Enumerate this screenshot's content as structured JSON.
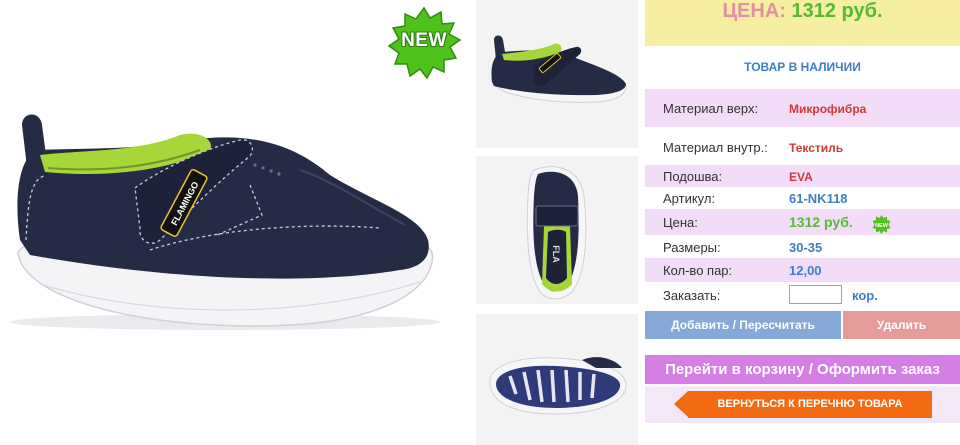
{
  "product": {
    "badge": "NEW",
    "brand_on_shoe": "FLAMINGO",
    "thumb_tongue_text": "FLA"
  },
  "price_banner": {
    "label": "ЦЕНА:",
    "value": "1312 руб."
  },
  "stock_status": "ТОВАР В НАЛИЧИИ",
  "specs": {
    "material_top": {
      "label": "Материал верх:",
      "value": "Микрофибра"
    },
    "material_inner": {
      "label": "Материал внутр.:",
      "value": "Текстиль"
    },
    "sole": {
      "label": "Подошва:",
      "value": "EVA"
    },
    "article": {
      "label": "Артикул:",
      "value": "61-NK118"
    },
    "price": {
      "label": "Цена:",
      "value": "1312 руб.",
      "badge": "NEW"
    },
    "sizes": {
      "label": "Размеры:",
      "value": "30-35"
    },
    "pairs": {
      "label": "Кол-во пар:",
      "value": "12,00"
    },
    "order": {
      "label": "Заказать:",
      "unit": "кор.",
      "value": ""
    }
  },
  "buttons": {
    "add": "Добавить / Пересчитать",
    "delete": "Удалить",
    "cart": "Перейти в корзину / Оформить заказ",
    "back": "ВЕРНУТЬСЯ К ПЕРЕЧНЮ ТОВАРА"
  },
  "colors": {
    "shoe_navy": "#252b45",
    "lining_lime": "#a6d63a",
    "price_green": "#55b932",
    "accent_blue": "#3f7ec4",
    "accent_orange": "#f26b12"
  }
}
